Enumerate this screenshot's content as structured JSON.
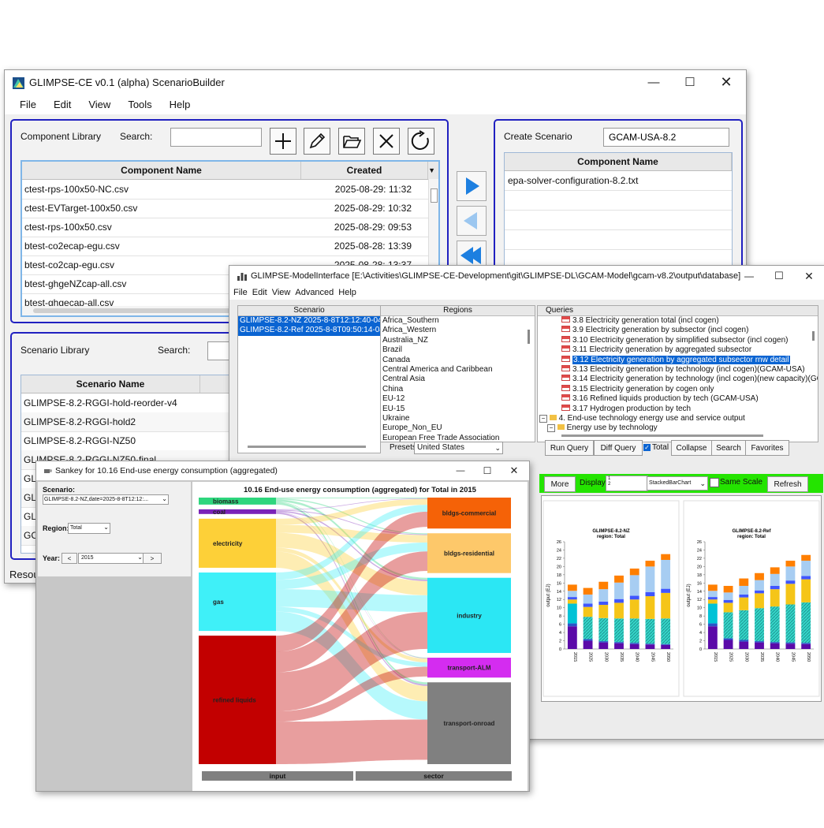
{
  "builder": {
    "title": "GLIMPSE-CE v0.1 (alpha) ScenarioBuilder",
    "menu": [
      "File",
      "Edit",
      "View",
      "Tools",
      "Help"
    ],
    "component_library": {
      "label": "Component Library",
      "search_label": "Search:",
      "search_value": "",
      "columns": [
        "Component Name",
        "Created"
      ],
      "rows": [
        {
          "name": "ctest-rps-100x50-NC.csv",
          "created": "2025-08-29: 11:32"
        },
        {
          "name": "ctest-EVTarget-100x50.csv",
          "created": "2025-08-29: 10:32"
        },
        {
          "name": "ctest-rps-100x50.csv",
          "created": "2025-08-29: 09:53"
        },
        {
          "name": "btest-co2ecap-egu.csv",
          "created": "2025-08-28: 13:39"
        },
        {
          "name": "btest-co2cap-egu.csv",
          "created": "2025-08-28: 13:37"
        },
        {
          "name": "btest-ghgeNZcap-all.csv",
          "created": ""
        },
        {
          "name": "btest-ghgecap-all.csv",
          "created": ""
        }
      ]
    },
    "create_scenario": {
      "label": "Create Scenario",
      "name_value": "GCAM-USA-8.2",
      "column": "Component Name",
      "rows": [
        "epa-solver-configuration-8.2.txt"
      ]
    },
    "scenario_library": {
      "label": "Scenario Library",
      "search_label": "Search:",
      "column": "Scenario Name",
      "rows": [
        "GLIMPSE-8.2-RGGI-hold-reorder-v4",
        "GLIMPSE-8.2-RGGI-hold2",
        "GLIMPSE-8.2-RGGI-NZ50",
        "GLIMPSE-8.2-RGGI-NZ50-final",
        "GLI",
        "GLI",
        "GLI",
        "GCA"
      ]
    },
    "status_prefix": "Resou"
  },
  "model": {
    "title": "GLIMPSE-ModelInterface [E:\\Activities\\GLIMPSE-CE-Development\\git\\GLIMPSE-DL\\GCAM-Model\\gcam-v8.2\\output\\database]",
    "menu": [
      "File",
      "Edit",
      "View",
      "Advanced",
      "Help"
    ],
    "scenario_header": "Scenario",
    "scenarios": [
      "GLIMPSE-8.2-NZ 2025-8-8T12:12:40-04:00",
      "GLIMPSE-8.2-Ref 2025-8-8T09:50:14-04:00"
    ],
    "regions_header": "Regions",
    "regions": [
      "Africa_Southern",
      "Africa_Western",
      "Australia_NZ",
      "Brazil",
      "Canada",
      "Central America and Caribbean",
      "Central Asia",
      "China",
      "EU-12",
      "EU-15",
      "Ukraine",
      "Europe_Non_EU",
      "European Free Trade Association"
    ],
    "presets_label": "Presets:",
    "presets_value": "United States",
    "queries_header": "Queries",
    "queries": [
      "3.8 Electricity generation total (incl cogen)",
      "3.9 Electricity generation by subsector (incl cogen)",
      "3.10 Electricity generation by simplified subsector (incl cogen)",
      "3.11 Electricity generation by aggregated subsector",
      "3.12 Electricity generation by aggregated subsector rnw detail",
      "3.13 Electricity generation by technology (incl cogen)(GCAM-USA)",
      "3.14 Electricity generation by technology (incl cogen)(new capacity)(GCAM",
      "3.15 Electricity generation by cogen only",
      "3.16 Refined liquids production by tech (GCAM-USA)",
      "3.17 Hydrogen production by tech"
    ],
    "query_folder": "4. End-use technology energy use and service output",
    "query_subfolder": "Energy use by technology",
    "buttons": [
      "Run Query",
      "Diff Query",
      "Total",
      "Collapse",
      "Search",
      "Favorites"
    ],
    "total_checked": true,
    "bar_more": "More",
    "bar_display": "Display",
    "bar_display_lines": [
      "1",
      "2"
    ],
    "bar_chart_type": "StackedBarChart",
    "bar_same_scale": "Same Scale",
    "bar_refresh": "Refresh"
  },
  "charts": {
    "colors": [
      "#5a0aa8",
      "#2a55c8",
      "#00c2d6",
      "#f5c518",
      "#3f56ff",
      "#a7cdf2",
      "#ff7f00"
    ],
    "chart_data": [
      {
        "type": "bar",
        "title": "GLIMPSE-8.2-NZ",
        "subtitle": "region: Total",
        "ylabel": "output (EJ)",
        "ylim": [
          0,
          26
        ],
        "yticks": [
          0,
          2,
          4,
          6,
          8,
          10,
          12,
          14,
          16,
          18,
          20,
          22,
          24,
          26
        ],
        "categories": [
          "2015",
          "2025",
          "2030",
          "2035",
          "2040",
          "2045",
          "2050"
        ],
        "series": [
          {
            "values": [
              5.5,
              2.0,
              1.6,
              1.4,
              1.2,
              1.1,
              1.0
            ]
          },
          {
            "values": [
              0.7,
              0.4,
              0.3,
              0.3,
              0.3,
              0.2,
              0.2
            ]
          },
          {
            "values": [
              4.8,
              5.4,
              5.6,
              5.7,
              5.9,
              6.0,
              6.2
            ]
          },
          {
            "values": [
              1.0,
              2.4,
              3.2,
              3.8,
              4.6,
              5.5,
              6.2
            ]
          },
          {
            "values": [
              0.6,
              0.8,
              0.8,
              0.9,
              0.9,
              1.0,
              1.0
            ]
          },
          {
            "values": [
              1.5,
              2.2,
              3.0,
              4.0,
              5.0,
              6.2,
              7.0
            ]
          },
          {
            "values": [
              1.5,
              1.6,
              1.8,
              1.7,
              1.6,
              1.4,
              1.4
            ]
          }
        ]
      },
      {
        "type": "bar",
        "title": "GLIMPSE-8.2-Ref",
        "subtitle": "region: Total",
        "ylabel": "output (EJ)",
        "ylim": [
          0,
          26
        ],
        "yticks": [
          0,
          2,
          4,
          6,
          8,
          10,
          12,
          14,
          16,
          18,
          20,
          22,
          24,
          26
        ],
        "categories": [
          "2015",
          "2025",
          "2030",
          "2035",
          "2040",
          "2045",
          "2050"
        ],
        "series": [
          {
            "values": [
              5.5,
              2.2,
              1.8,
              1.6,
              1.4,
              1.3,
              1.2
            ]
          },
          {
            "values": [
              0.7,
              0.4,
              0.4,
              0.3,
              0.3,
              0.3,
              0.3
            ]
          },
          {
            "values": [
              4.8,
              6.3,
              7.2,
              8.0,
              8.6,
              9.2,
              9.8
            ]
          },
          {
            "values": [
              1.0,
              2.3,
              3.1,
              3.6,
              4.2,
              5.0,
              5.6
            ]
          },
          {
            "values": [
              0.6,
              0.7,
              0.7,
              0.7,
              0.8,
              0.8,
              0.8
            ]
          },
          {
            "values": [
              1.5,
              1.8,
              2.1,
              2.5,
              2.9,
              3.4,
              3.7
            ]
          },
          {
            "values": [
              1.5,
              1.6,
              1.8,
              1.7,
              1.6,
              1.4,
              1.4
            ]
          }
        ]
      }
    ]
  },
  "sankey": {
    "title": "Sankey for 10.16 End-use energy consumption (aggregated)",
    "scenario_label": "Scenario:",
    "scenario_value": "GLIMPSE-8.2-NZ,date=2025-8-8T12:12:...",
    "region_label": "Region:",
    "region_value": "Total",
    "year_label": "Year:",
    "year_value": "2015",
    "prev": "<",
    "next": ">",
    "chart_data": {
      "type": "sankey",
      "title": "10.16 End-use energy consumption (aggregated) for Total in 2015",
      "inputs": [
        {
          "name": "biomass",
          "value": 3
        },
        {
          "name": "coal",
          "value": 2
        },
        {
          "name": "electricity",
          "value": 21
        },
        {
          "name": "gas",
          "value": 25
        },
        {
          "name": "refined liquids",
          "value": 55
        }
      ],
      "sectors": [
        {
          "name": "bldgs-commercial",
          "value": 14
        },
        {
          "name": "bldgs-residential",
          "value": 18
        },
        {
          "name": "industry",
          "value": 34
        },
        {
          "name": "transport-ALM",
          "value": 9
        },
        {
          "name": "transport-onroad",
          "value": 37
        }
      ],
      "input_colors": [
        "#2ed67d",
        "#7a22b8",
        "#fdd038",
        "#3ff0f8",
        "#c20000"
      ],
      "sector_colors": [
        "#f56207",
        "#fdc86a",
        "#2be7f4",
        "#d42cf0",
        "#808080"
      ],
      "footer": [
        "input",
        "sector"
      ]
    }
  }
}
